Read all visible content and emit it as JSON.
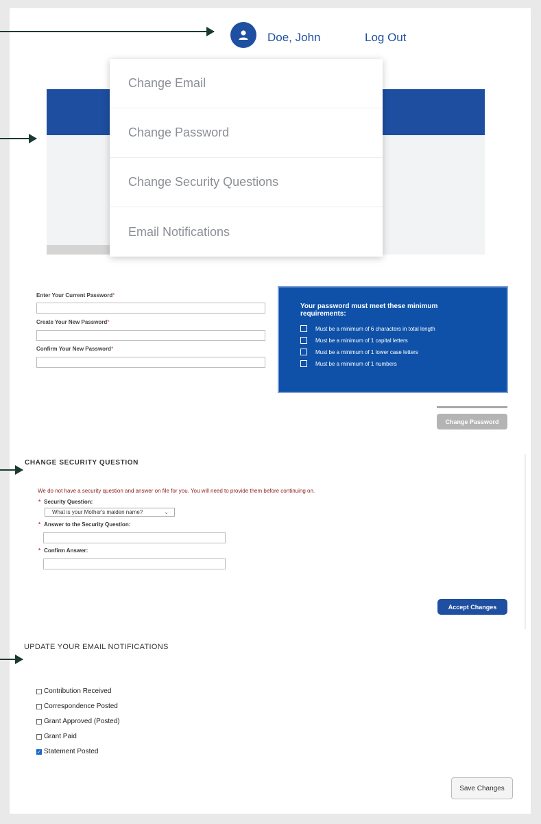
{
  "header": {
    "user_name": "Doe, John",
    "logout_label": "Log Out",
    "avatar_icon": "user-icon"
  },
  "menu": {
    "items": [
      {
        "label": "Change Email"
      },
      {
        "label": "Change Password"
      },
      {
        "label": "Change Security Questions"
      },
      {
        "label": "Email Notifications"
      }
    ]
  },
  "password": {
    "current_label": "Enter Your Current Password",
    "new_label": "Create Your New Password",
    "confirm_label": "Confirm Your New Password",
    "required_mark": "*",
    "requirements_title": "Your password must meet these minimum requirements:",
    "requirements": [
      {
        "text": "Must be a minimum of 6 characters in total length"
      },
      {
        "text": "Must be a minimum of 1 capital letters"
      },
      {
        "text": "Must be a minimum of 1 lower case letters"
      },
      {
        "text": "Must be a minimum of 1 numbers"
      }
    ],
    "button_label": "Change Password"
  },
  "security": {
    "title": "CHANGE SECURITY QUESTION",
    "notice": "We do not have a security question and answer on file for you. You will need to provide them before continuing on.",
    "question_label": "Security Question:",
    "question_value": "What is your Mother's maiden name?",
    "answer_label": "Answer to the Security Question:",
    "confirm_label": "Confirm Answer:",
    "required_mark": "*",
    "button_label": "Accept Changes"
  },
  "notifications": {
    "title": "UPDATE YOUR EMAIL NOTIFICATIONS",
    "items": [
      {
        "label": "Contribution Received",
        "checked": false
      },
      {
        "label": "Correspondence Posted",
        "checked": false
      },
      {
        "label": "Grant Approved (Posted)",
        "checked": false
      },
      {
        "label": "Grant Paid",
        "checked": false
      },
      {
        "label": "Statement Posted",
        "checked": true
      }
    ],
    "button_label": "Save Changes"
  },
  "colors": {
    "brand_blue": "#1f4fa0",
    "requirements_bg": "#0f51a8",
    "arrow": "#1b3a34",
    "error_text": "#8a1d1d"
  }
}
